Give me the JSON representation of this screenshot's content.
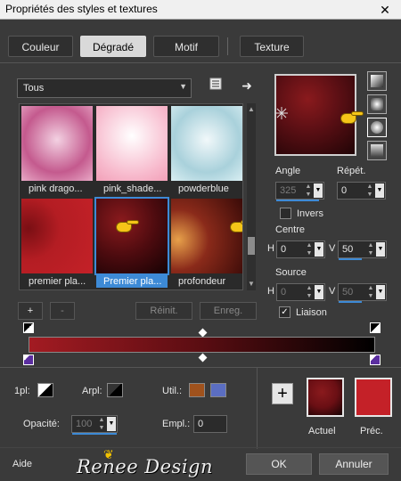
{
  "window": {
    "title": "Propriétés des styles et textures",
    "close": "✕"
  },
  "tabs": [
    {
      "label": "Couleur",
      "active": false
    },
    {
      "label": "Dégradé",
      "active": true
    },
    {
      "label": "Motif",
      "active": false
    },
    {
      "label": "Texture",
      "active": false
    }
  ],
  "category": {
    "value": "Tous",
    "icon": "list-icon",
    "next_icon": "arrow-right-icon"
  },
  "gradients": [
    {
      "label": "pink drago...",
      "colors": [
        "#e8a9c6",
        "#c45a8e",
        "#f3d1e2"
      ]
    },
    {
      "label": "pink_shade...",
      "colors": [
        "#ffffff",
        "#f7b9cc",
        "#f2a0b8"
      ]
    },
    {
      "label": "powderblue",
      "colors": [
        "#d9eef2",
        "#a9d1db",
        "#f1f8fa"
      ]
    },
    {
      "label": "premier pla...",
      "colors": [
        "#b41d23",
        "#c42128",
        "#7a0f14"
      ]
    },
    {
      "label": "Premier pla...",
      "colors": [
        "#8a1a1d",
        "#4d0b0f",
        "#150203"
      ],
      "selected": true
    },
    {
      "label": "profondeur",
      "colors": [
        "#e7a04a",
        "#8a2a1a",
        "#3a0b08"
      ]
    }
  ],
  "list_buttons": {
    "add": "+",
    "remove": "-",
    "reset": "Réinit.",
    "save": "Enreg."
  },
  "angle": {
    "label": "Angle",
    "value": "325"
  },
  "repeat": {
    "label": "Répét.",
    "value": "0"
  },
  "invert": {
    "label": "Invers",
    "checked": false
  },
  "centre": {
    "label": "Centre",
    "h_label": "H",
    "h": "0",
    "v_label": "V",
    "v": "50"
  },
  "source": {
    "label": "Source",
    "h_label": "H",
    "h": "0",
    "v_label": "V",
    "v": "50"
  },
  "link": {
    "label": "Liaison",
    "checked": true
  },
  "stops": {
    "start_color": "#a31b22",
    "end_color": "#000000",
    "midpoint_pct": 50
  },
  "bottom": {
    "opacity_label": "1pl:",
    "arpl_label": "Arpl:",
    "util_label": "Util.:",
    "opacity_field_label": "Opacité:",
    "opacity_value": "100",
    "empl_label": "Empl.:",
    "empl_value": "0",
    "util_color1": "#a0521d",
    "util_color2": "#5b6ec2"
  },
  "swatches": {
    "actuel_label": "Actuel",
    "prec_label": "Préc.",
    "actuel_color": "#6a0f14",
    "prec_color": "#c42128"
  },
  "footer": {
    "help": "Aide",
    "logo": "Renee Design",
    "ok": "OK",
    "cancel": "Annuler"
  }
}
